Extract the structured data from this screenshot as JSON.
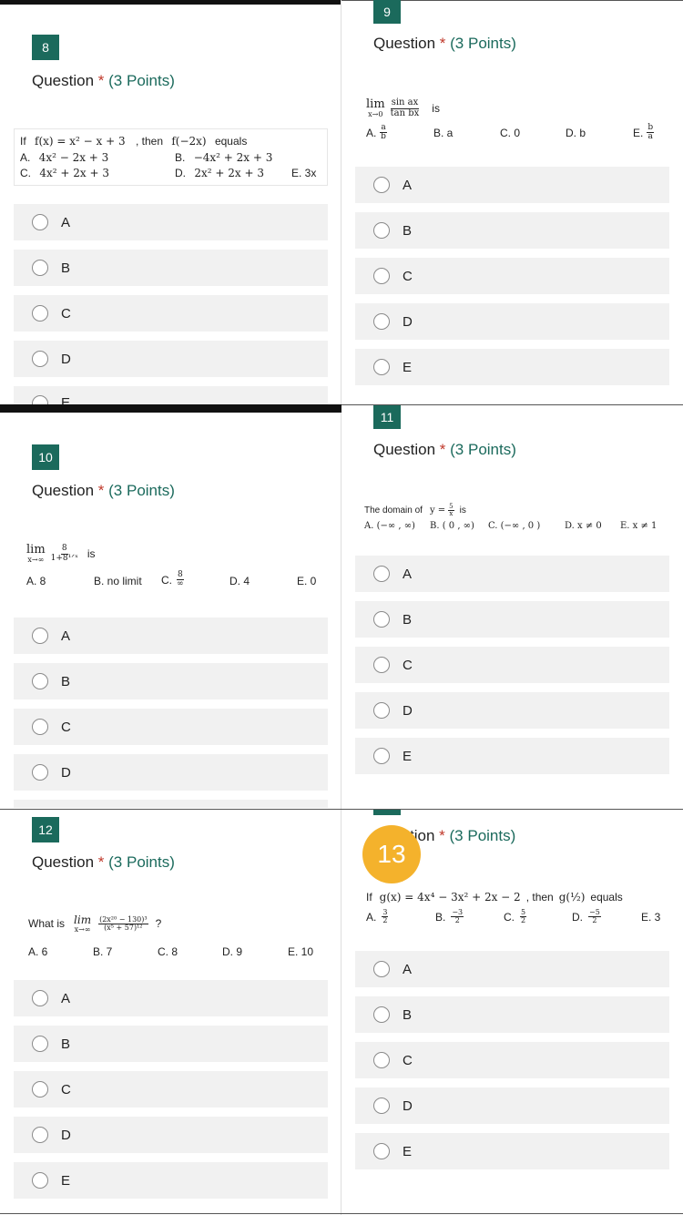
{
  "q8": {
    "number": "8",
    "title_prefix": "Question",
    "star": "*",
    "points": "(3 Points)",
    "stem_if": "If",
    "fx": "f(x) = x² − x + 3",
    "then": ", then",
    "f_neg2x": "f(−2x)",
    "equals": "equals",
    "a_lbl": "A.",
    "a_val": "4x² − 2x + 3",
    "b_lbl": "B.",
    "b_val": "−4x² + 2x + 3",
    "c_lbl": "C.",
    "c_val": "4x² + 2x + 3",
    "d_lbl": "D.",
    "d_val": "2x² + 2x + 3",
    "e_val": "E. 3x",
    "options": [
      "A",
      "B",
      "C",
      "D",
      "E"
    ]
  },
  "q9": {
    "number": "9",
    "title_prefix": "Question",
    "star": "*",
    "points": "(3 Points)",
    "lim": "lim",
    "lim_sub": "x→0",
    "frac_num": "sin ax",
    "frac_den": "tan bx",
    "is": "is",
    "a_lbl": "A.",
    "a_num": "a",
    "a_den": "b",
    "b_val": "B.  a",
    "c_val": "C. 0",
    "d_val": "D.  b",
    "e_lbl": "E.",
    "e_num": "b",
    "e_den": "a",
    "options": [
      "A",
      "B",
      "C",
      "D",
      "E"
    ]
  },
  "q10": {
    "number": "10",
    "title_prefix": "Question",
    "star": "*",
    "points": "(3 Points)",
    "lim": "lim",
    "lim_sub": "x→∞",
    "frac_num": "8",
    "frac_den": "1+8¹ᐟˣ",
    "is": "is",
    "a_val": "A.  8",
    "b_val": "B.  no limit",
    "c_lbl": "C.",
    "c_num": "8",
    "c_den": "∞",
    "d_val": "D.  4",
    "e_val": "E. 0",
    "options": [
      "A",
      "B",
      "C",
      "D"
    ]
  },
  "q11": {
    "number": "11",
    "title_prefix": "Question",
    "star": "*",
    "points": "(3 Points)",
    "stem": "The domain of",
    "y_eq": "y =",
    "y_num": "5",
    "y_den": "x",
    "is": "is",
    "a_val": "A.  (−∞ , ∞)",
    "b_val": "B.  ( 0 , ∞)",
    "c_val": "C.  (−∞ , 0 )",
    "d_val": "D.  x ≠ 0",
    "e_val": "E. x ≠ 1",
    "options": [
      "A",
      "B",
      "C",
      "D",
      "E"
    ]
  },
  "q12": {
    "number": "12",
    "title_prefix": "Question",
    "star": "*",
    "points": "(3 Points)",
    "stem": "What is",
    "lim": "lim",
    "lim_sub": "x→∞",
    "frac_num": "(2x²⁰ − 130)³",
    "frac_den": "(x⁵ + 57)¹²",
    "q": "?",
    "a_val": "A.  6",
    "b_val": "B.  7",
    "c_val": "C.  8",
    "d_val": "D.  9",
    "e_val": "E.  10",
    "options": [
      "A",
      "B",
      "C",
      "D",
      "E"
    ]
  },
  "q13": {
    "badge": "13",
    "title_partial": "tion",
    "star": "*",
    "points": "(3 Points)",
    "stem_if": "If",
    "gx": "g(x) = 4x⁴ − 3x² + 2x − 2",
    "then": ", then",
    "g_half": "g(½)",
    "equals": "equals",
    "a_lbl": "A.",
    "a_num": "3",
    "a_den": "2",
    "b_lbl": "B.",
    "b_num": "−3",
    "b_den": "2",
    "c_lbl": "C.",
    "c_num": "5",
    "c_den": "2",
    "d_lbl": "D.",
    "d_num": "−5",
    "d_den": "2",
    "e_val": "E. 3",
    "options": [
      "A",
      "B",
      "C",
      "D",
      "E"
    ]
  }
}
